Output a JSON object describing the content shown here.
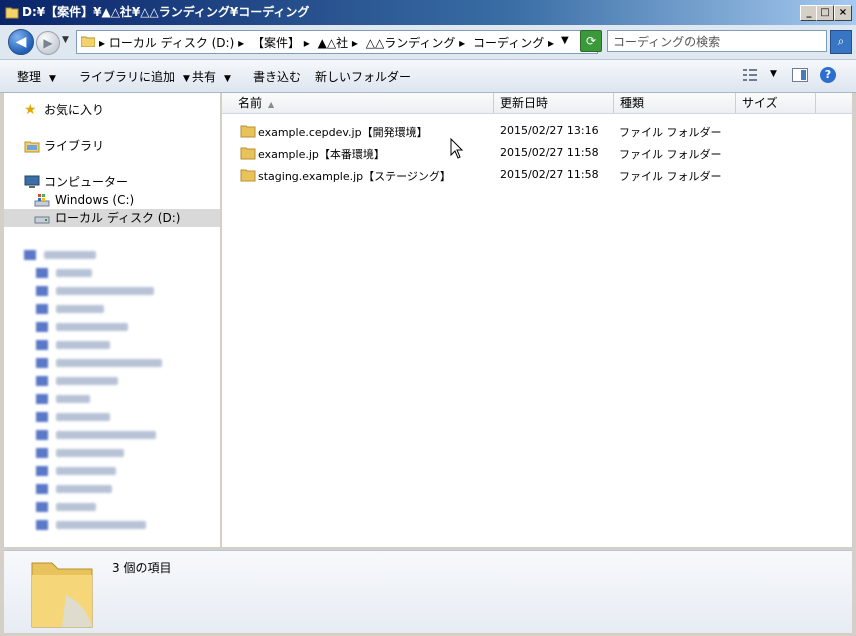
{
  "window": {
    "title": "D:¥【案件】¥▲△社¥△△ランディング¥コーディング",
    "controls": [
      "_",
      "□",
      "×"
    ]
  },
  "address": {
    "crumbs": [
      "▸ ローカル ディスク (D:) ▸",
      "【案件】 ▸",
      "▲△社 ▸",
      "△△ランディング ▸",
      "コーディング ▸"
    ],
    "search_placeholder": "コーディングの検索"
  },
  "toolbar": {
    "organize": "整理",
    "add_to_library": "ライブラリに追加",
    "share": "共有",
    "burn": "書き込む",
    "new_folder": "新しいフォルダー"
  },
  "nav": {
    "favorites": "お気に入り",
    "libraries": "ライブラリ",
    "computer": "コンピューター",
    "drive_c": "Windows (C:)",
    "drive_d": "ローカル ディスク (D:)"
  },
  "columns": {
    "name": "名前",
    "date": "更新日時",
    "type": "種類",
    "size": "サイズ"
  },
  "files": [
    {
      "name": "example.cepdev.jp【開発環境】",
      "date": "2015/02/27 13:16",
      "type": "ファイル フォルダー"
    },
    {
      "name": "example.jp【本番環境】",
      "date": "2015/02/27 11:58",
      "type": "ファイル フォルダー"
    },
    {
      "name": "staging.example.jp【ステージング】",
      "date": "2015/02/27 11:58",
      "type": "ファイル フォルダー"
    }
  ],
  "details": {
    "item_count": "3 個の項目"
  },
  "colors": {
    "titlebar": "#0a246a",
    "folder": "#e8c25a",
    "selection": "#d9d9d9"
  }
}
